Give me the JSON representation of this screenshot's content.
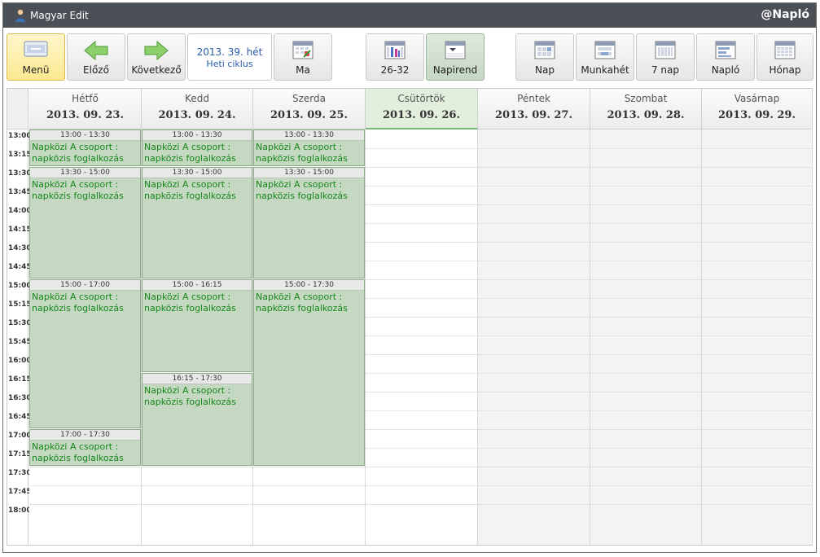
{
  "window": {
    "title": "Magyar Edit",
    "brand": "@Napló"
  },
  "toolbar": {
    "menu": "Menü",
    "prev": "Előző",
    "next": "Következő",
    "week_line1": "2013. 39. hét",
    "week_line2": "Heti ciklus",
    "today": "Ma",
    "range": "26-32",
    "schedule": "Napirend",
    "day": "Nap",
    "workweek": "Munkahét",
    "seven_days": "7 nap",
    "journal": "Napló",
    "month": "Hónap"
  },
  "days": [
    {
      "name": "Hétfő",
      "date": "2013. 09. 23."
    },
    {
      "name": "Kedd",
      "date": "2013. 09. 24."
    },
    {
      "name": "Szerda",
      "date": "2013. 09. 25."
    },
    {
      "name": "Csütörtök",
      "date": "2013. 09. 26."
    },
    {
      "name": "Péntek",
      "date": "2013. 09. 27."
    },
    {
      "name": "Szombat",
      "date": "2013. 09. 28."
    },
    {
      "name": "Vasárnap",
      "date": "2013. 09. 29."
    }
  ],
  "times": [
    "13:00",
    "13:15",
    "13:30",
    "13:45",
    "14:00",
    "14:15",
    "14:30",
    "14:45",
    "15:00",
    "15:15",
    "15:30",
    "15:45",
    "16:00",
    "16:15",
    "16:30",
    "16:45",
    "17:00",
    "17:15",
    "17:30",
    "17:45",
    "18:00"
  ],
  "events": [
    {
      "day": 0,
      "start": "13:00",
      "end": "13:30",
      "time": "13:00 - 13:30",
      "text": "Napközi A csoport : napközis foglalkozás"
    },
    {
      "day": 0,
      "start": "13:30",
      "end": "15:00",
      "time": "13:30 - 15:00",
      "text": "Napközi A csoport : napközis foglalkozás"
    },
    {
      "day": 0,
      "start": "15:00",
      "end": "17:00",
      "time": "15:00 - 17:00",
      "text": "Napközi A csoport : napközis foglalkozás"
    },
    {
      "day": 0,
      "start": "17:00",
      "end": "17:30",
      "time": "17:00 - 17:30",
      "text": "Napközi A csoport : napközis foglalkozás"
    },
    {
      "day": 1,
      "start": "13:00",
      "end": "13:30",
      "time": "13:00 - 13:30",
      "text": "Napközi A csoport : napközis foglalkozás"
    },
    {
      "day": 1,
      "start": "13:30",
      "end": "15:00",
      "time": "13:30 - 15:00",
      "text": "Napközi A csoport : napközis foglalkozás"
    },
    {
      "day": 1,
      "start": "15:00",
      "end": "16:15",
      "time": "15:00 - 16:15",
      "text": "Napközi A csoport : napközis foglalkozás"
    },
    {
      "day": 1,
      "start": "16:15",
      "end": "17:30",
      "time": "16:15 - 17:30",
      "text": "Napközi A csoport : napközis foglalkozás"
    },
    {
      "day": 2,
      "start": "13:00",
      "end": "13:30",
      "time": "13:00 - 13:30",
      "text": "Napközi A csoport : napközis foglalkozás"
    },
    {
      "day": 2,
      "start": "13:30",
      "end": "15:00",
      "time": "13:30 - 15:00",
      "text": "Napközi A csoport : napközis foglalkozás"
    },
    {
      "day": 2,
      "start": "15:00",
      "end": "17:30",
      "time": "15:00 - 17:30",
      "text": "Napközi A csoport : napközis foglalkozás"
    }
  ],
  "today_index": 3,
  "colors": {
    "event_bg": "#c5d9c2",
    "event_text": "#17851a",
    "title_bar": "#4b4f56",
    "accent": "#2a5ca8"
  }
}
